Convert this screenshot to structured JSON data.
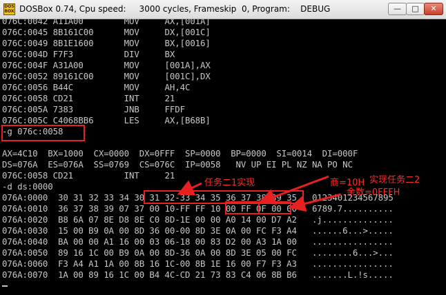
{
  "window": {
    "icon_text": "DOS BOX",
    "title": "DOSBox 0.74, Cpu speed:     3000 cycles, Frameskip  0, Program:    DEBUG",
    "minimize": "—",
    "maximize": "□",
    "close": "✕"
  },
  "console": {
    "lines": [
      "076C:0042 A11A00        MOV     AX,[001A]",
      "076C:0045 8B161C00      MOV     DX,[001C]",
      "076C:0049 8B1E1600      MOV     BX,[0016]",
      "076C:004D F7F3          DIV     BX",
      "076C:004F A31A00        MOV     [001A],AX",
      "076C:0052 89161C00      MOV     [001C],DX",
      "076C:0056 B44C          MOV     AH,4C",
      "076C:0058 CD21          INT     21",
      "076C:005A 7383          JNB     FFDF",
      "076C:005C C4068BB6      LES     AX,[B68B]",
      "-g 076c:0058",
      "",
      "AX=4C10  BX=1000  CX=0000  DX=0FFF  SP=0000  BP=0000  SI=0014  DI=000F",
      "DS=076A  ES=076A  SS=0769  CS=076C  IP=0058   NV UP EI PL NZ NA PO NC",
      "076C:0058 CD21          INT     21",
      "-d ds:0000",
      "076A:0000  30 31 32 33 34 30 31 32-33 34 35 36 37 38 39 35   0123401234567895",
      "076A:0010  36 37 38 39 07 37 00 10-FF FF 10 00 FF 0F 00 00   6789.7..........",
      "076A:0020  B8 6A 07 8E D8 8E C0 8D-1E 00 00 A0 14 00 D7 A2   .j..............",
      "076A:0030  15 00 B9 0A 00 8D 36 00-00 8D 3E 0A 00 FC F3 A4   ......6...>.....",
      "076A:0040  BA 00 00 A1 16 00 03 06-18 00 83 D2 00 A3 1A 00   ................",
      "076A:0050  89 16 1C 00 B9 0A 00 8D-36 0A 00 8D 3E 05 00 FC   ........6...>...",
      "076A:0060  F3 A4 A1 1A 00 8B 16 1C-00 8B 1E 16 00 F7 F3 A3   ................",
      "076A:0070  1A 00 89 16 1C 00 B4 4C-CD 21 73 83 C4 06 8B B6   .......L.!s....."
    ]
  },
  "annotations": {
    "task21": "任务二1实现",
    "quotient": "商=10H",
    "task22": "实现任务二2",
    "remainder": "余数=0FFFH"
  },
  "colors": {
    "annotation": "#e82020",
    "console_text": "#c8c8c8",
    "background": "#000000"
  }
}
